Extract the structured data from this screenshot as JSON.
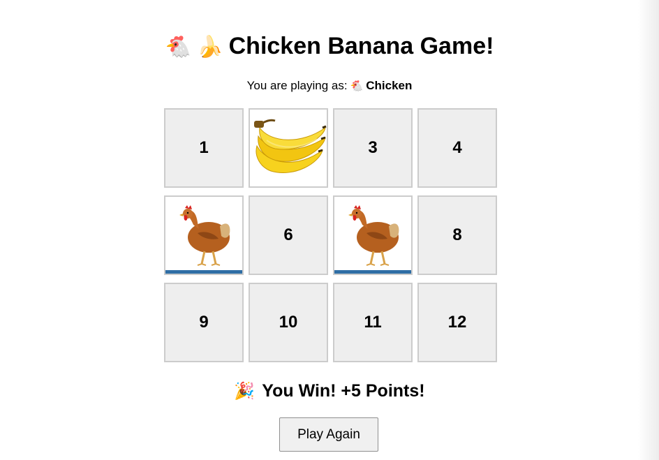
{
  "title": {
    "emoji": "🐔 🍌",
    "text": "Chicken Banana Game!"
  },
  "player": {
    "prefix": "You are playing as:",
    "emoji": "🐔",
    "name": "Chicken"
  },
  "board": {
    "tiles": [
      {
        "label": "1",
        "state": "hidden"
      },
      {
        "label": "",
        "state": "revealed",
        "image": "banana-image"
      },
      {
        "label": "3",
        "state": "hidden"
      },
      {
        "label": "4",
        "state": "hidden"
      },
      {
        "label": "",
        "state": "revealed",
        "image": "chicken-image"
      },
      {
        "label": "6",
        "state": "hidden"
      },
      {
        "label": "",
        "state": "revealed",
        "image": "chicken-image"
      },
      {
        "label": "8",
        "state": "hidden"
      },
      {
        "label": "9",
        "state": "hidden"
      },
      {
        "label": "10",
        "state": "hidden"
      },
      {
        "label": "11",
        "state": "hidden"
      },
      {
        "label": "12",
        "state": "hidden"
      }
    ]
  },
  "result": {
    "emoji": "🎉",
    "text": "You Win! +5 Points!"
  },
  "play_again_label": "Play Again",
  "colors": {
    "tile_background": "#eeeeee",
    "tile_border": "#cccccc",
    "banana_yellow": "#f7d21e",
    "chicken_brown": "#b5601f"
  }
}
